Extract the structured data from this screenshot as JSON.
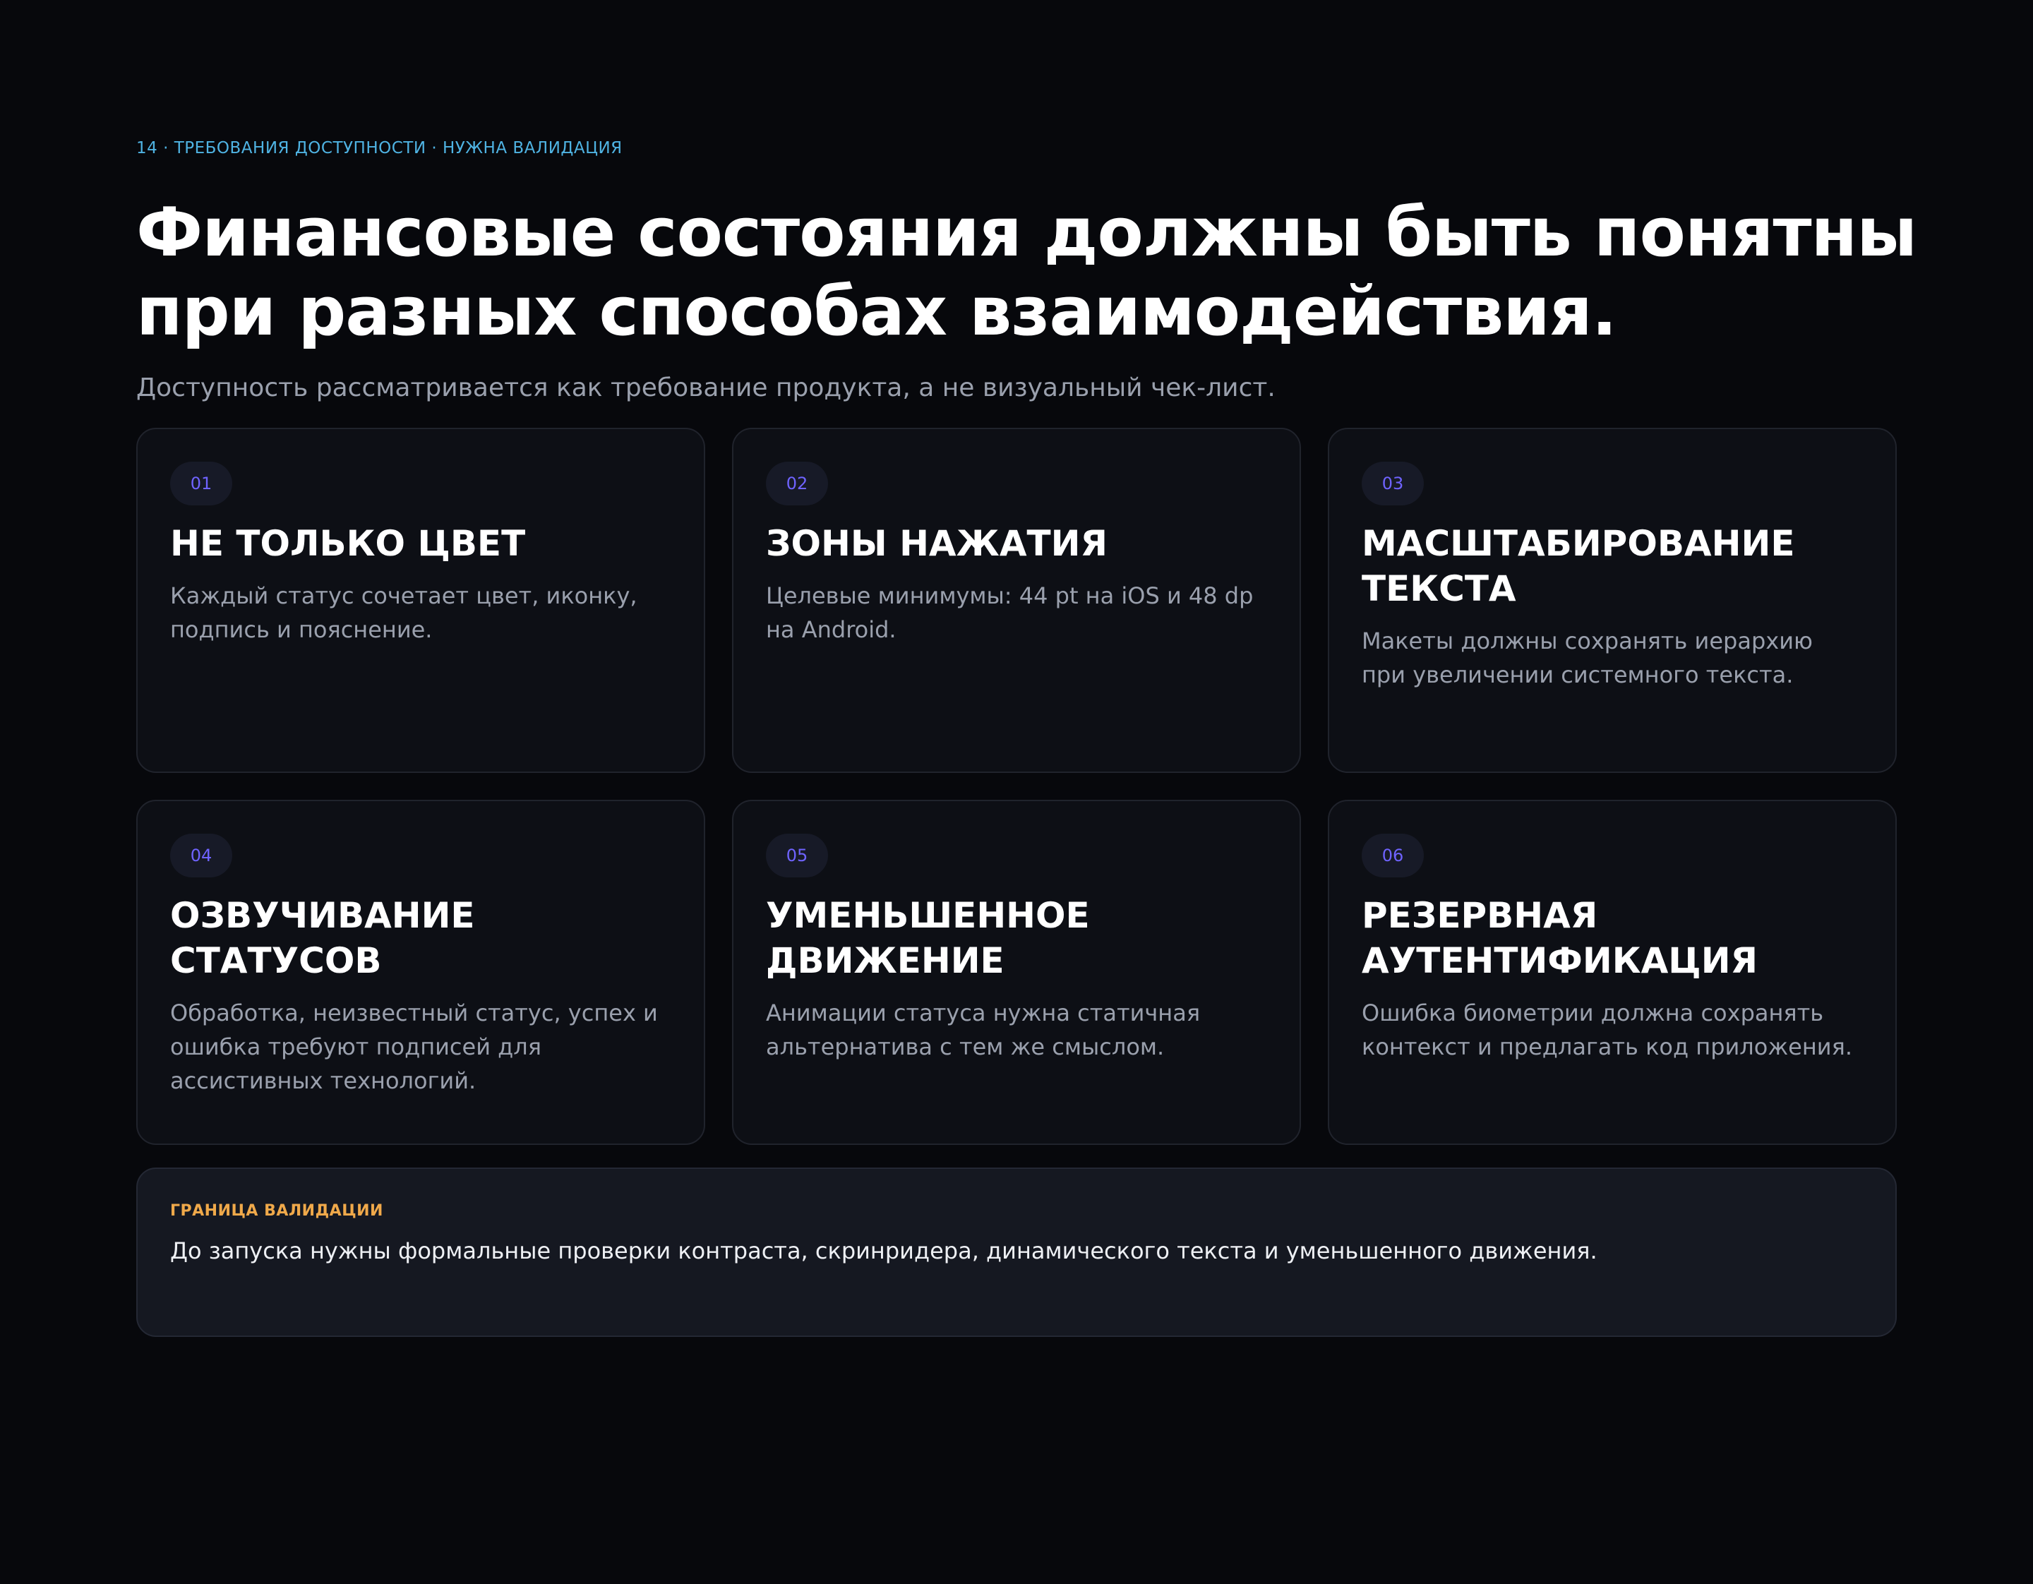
{
  "header": {
    "eyebrow": "14 · ТРЕБОВАНИЯ ДОСТУПНОСТИ · НУЖНА ВАЛИДАЦИЯ",
    "title": "Финансовые состояния должны быть понятны при разных способах взаимодействия.",
    "subtitle": "Доступность рассматривается как требование продукта, а не визуальный чек-лист."
  },
  "cards": [
    {
      "number": "01",
      "title": "НЕ ТОЛЬКО ЦВЕТ",
      "body": "Каждый статус сочетает цвет, иконку, подпись и пояснение."
    },
    {
      "number": "02",
      "title": "ЗОНЫ НАЖАТИЯ",
      "body": "Целевые минимумы: 44 pt на iOS и 48 dp на Android."
    },
    {
      "number": "03",
      "title": "МАСШТАБИРОВАНИЕ ТЕКСТА",
      "body": "Макеты должны сохранять иерархию при увеличении системного текста."
    },
    {
      "number": "04",
      "title": "ОЗВУЧИВАНИЕ СТАТУСОВ",
      "body": "Обработка, неизвестный статус, успех и ошибка требуют подписей для ассистивных технологий."
    },
    {
      "number": "05",
      "title": "УМЕНЬШЕННОЕ ДВИЖЕНИЕ",
      "body": "Анимации статуса нужна статичная альтернатива с тем же смыслом."
    },
    {
      "number": "06",
      "title": "РЕЗЕРВНАЯ АУТЕНТИФИКАЦИЯ",
      "body": "Ошибка биометрии должна сохранять контекст и предлагать код приложения."
    }
  ],
  "callout": {
    "label": "ГРАНИЦА ВАЛИДАЦИИ",
    "text": "До запуска нужны формальные проверки контраста, скринридера, динамического текста и уменьшенного движения."
  },
  "colors": {
    "background": "#07080c",
    "eyebrow": "#4fb3e3",
    "badge_text": "#6f63ff",
    "callout_label": "#f0a94a"
  }
}
